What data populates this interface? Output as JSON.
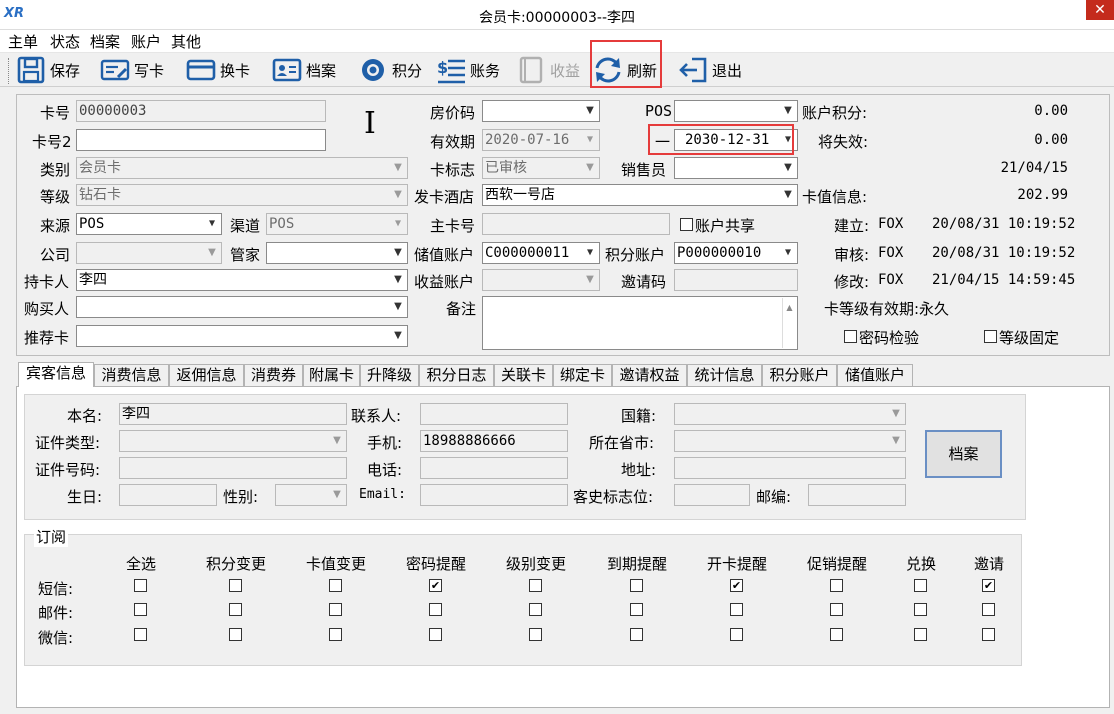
{
  "window": {
    "title": "会员卡:00000003--李四",
    "app_icon": "XR",
    "close": "✕"
  },
  "menu": [
    "主单",
    "状态",
    "档案",
    "账户",
    "其他"
  ],
  "toolbar": {
    "save": "保存",
    "write_card": "写卡",
    "change_card": "换卡",
    "archive": "档案",
    "points": "积分",
    "account": "账务",
    "revenue": "收益",
    "refresh": "刷新",
    "exit": "退出"
  },
  "form": {
    "card_no": {
      "label": "卡号",
      "value": "00000003"
    },
    "card_no2": {
      "label": "卡号2",
      "value": ""
    },
    "category": {
      "label": "类别",
      "value": "会员卡"
    },
    "level": {
      "label": "等级",
      "value": "钻石卡"
    },
    "source": {
      "label": "来源",
      "value": "POS"
    },
    "channel": {
      "label": "渠道",
      "value": "POS"
    },
    "company": {
      "label": "公司",
      "value": ""
    },
    "housekeeper": {
      "label": "管家",
      "value": ""
    },
    "holder": {
      "label": "持卡人",
      "value": "李四"
    },
    "buyer": {
      "label": "购买人",
      "value": ""
    },
    "referrer": {
      "label": "推荐卡",
      "value": ""
    },
    "room_rate": {
      "label": "房价码",
      "value": ""
    },
    "valid_from": {
      "label": "有效期",
      "value": "2020-07-16"
    },
    "valid_sep": "一",
    "valid_to": "2030-12-31",
    "card_flag": {
      "label": "卡标志",
      "value": "已审核"
    },
    "issue_hotel": {
      "label": "发卡酒店",
      "value": "西软一号店"
    },
    "main_card": {
      "label": "主卡号",
      "value": ""
    },
    "share_account": "账户共享",
    "stored_account": {
      "label": "储值账户",
      "value": "C000000011"
    },
    "points_account": {
      "label": "积分账户",
      "value": "P000000010"
    },
    "revenue_account": {
      "label": "收益账户",
      "value": ""
    },
    "invite_code": {
      "label": "邀请码",
      "value": ""
    },
    "remark": {
      "label": "备注",
      "value": ""
    },
    "pos": {
      "label": "POS",
      "value": ""
    },
    "salesperson": {
      "label": "销售员",
      "value": ""
    }
  },
  "summary": {
    "account_points": {
      "label": "账户积分:",
      "value": "0.00"
    },
    "expiring": {
      "label": "将失效:",
      "value": "0.00"
    },
    "expiring_date": "21/04/15",
    "card_value": {
      "label": "卡值信息:",
      "value": "202.99"
    },
    "created": {
      "label": "建立:",
      "user": "FOX",
      "time": "20/08/31 10:19:52"
    },
    "audited": {
      "label": "审核:",
      "user": "FOX",
      "time": "20/08/31 10:19:52"
    },
    "modified": {
      "label": "修改:",
      "user": "FOX",
      "time": "21/04/15 14:59:45"
    },
    "level_validity": "卡等级有效期:永久",
    "password_check": "密码检验",
    "level_fixed": "等级固定"
  },
  "tabs": [
    "宾客信息",
    "消费信息",
    "返佣信息",
    "消费券",
    "附属卡",
    "升降级",
    "积分日志",
    "关联卡",
    "绑定卡",
    "邀请权益",
    "统计信息",
    "积分账户",
    "储值账户"
  ],
  "guest": {
    "name": {
      "label": "本名:",
      "value": "李四"
    },
    "id_type": {
      "label": "证件类型:",
      "value": ""
    },
    "id_no": {
      "label": "证件号码:",
      "value": ""
    },
    "birthday": {
      "label": "生日:",
      "value": ""
    },
    "gender": {
      "label": "性别:",
      "value": ""
    },
    "contact": {
      "label": "联系人:",
      "value": ""
    },
    "mobile": {
      "label": "手机:",
      "value": "18988886666"
    },
    "phone": {
      "label": "电话:",
      "value": ""
    },
    "email": {
      "label": "Email:",
      "value": ""
    },
    "nationality": {
      "label": "国籍:",
      "value": ""
    },
    "province": {
      "label": "所在省市:",
      "value": ""
    },
    "address": {
      "label": "地址:",
      "value": ""
    },
    "guest_flag": {
      "label": "客史标志位:",
      "value": ""
    },
    "postcode": {
      "label": "邮编:",
      "value": ""
    },
    "archive_button": "档案"
  },
  "subscribe": {
    "title": "订阅",
    "columns": [
      "全选",
      "积分变更",
      "卡值变更",
      "密码提醒",
      "级别变更",
      "到期提醒",
      "开卡提醒",
      "促销提醒",
      "兑换",
      "邀请"
    ],
    "rows": [
      {
        "label": "短信:",
        "checked": [
          false,
          false,
          false,
          true,
          false,
          false,
          true,
          false,
          false,
          true
        ]
      },
      {
        "label": "邮件:",
        "checked": [
          false,
          false,
          false,
          false,
          false,
          false,
          false,
          false,
          false,
          false
        ]
      },
      {
        "label": "微信:",
        "checked": [
          false,
          false,
          false,
          false,
          false,
          false,
          false,
          false,
          false,
          false
        ]
      }
    ]
  },
  "colors": {
    "highlight": "#e53b3b",
    "close_button": "#c42b1c",
    "toolbar_icon": "#1f5fa8"
  }
}
